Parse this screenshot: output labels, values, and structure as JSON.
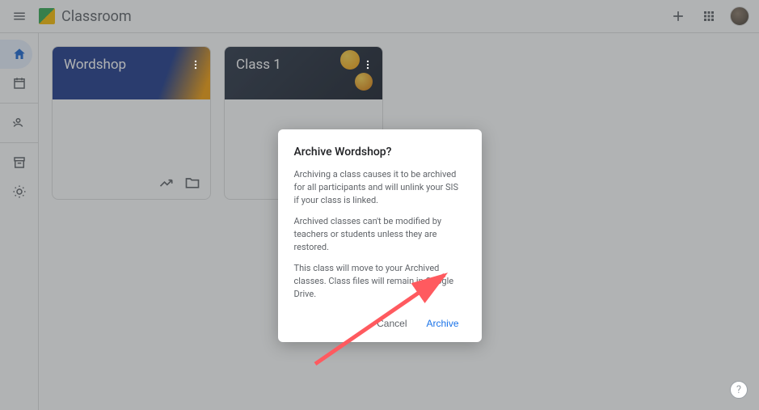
{
  "header": {
    "app_title": "Classroom"
  },
  "classes": [
    {
      "title": "Wordshop"
    },
    {
      "title": "Class 1"
    }
  ],
  "dialog": {
    "title": "Archive Wordshop?",
    "p1": "Archiving a class causes it to be archived for all participants and will unlink your SIS if your class is linked.",
    "p2": "Archived classes can't be modified by teachers or students unless they are restored.",
    "p3": "This class will move to your Archived classes. Class files will remain in Google Drive.",
    "cancel_label": "Cancel",
    "archive_label": "Archive"
  },
  "help_label": "?"
}
